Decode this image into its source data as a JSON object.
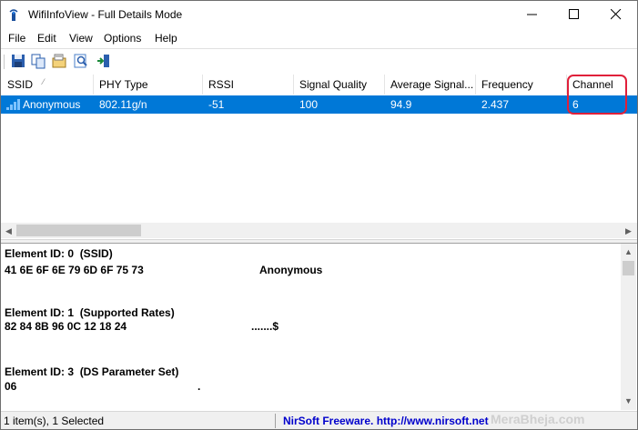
{
  "window": {
    "title": "WifiInfoView  -  Full Details Mode"
  },
  "menu": [
    "File",
    "Edit",
    "View",
    "Options",
    "Help"
  ],
  "toolbar": {
    "icons": [
      "save-icon",
      "copy-icon",
      "properties-icon",
      "find-icon",
      "exit-icon"
    ]
  },
  "list": {
    "columns": [
      "SSID",
      "PHY Type",
      "RSSI",
      "Signal Quality",
      "Average Signal...",
      "Frequency",
      "Channel"
    ],
    "rows": [
      {
        "ssid": "Anonymous",
        "phy": "802.11g/n",
        "rssi": "-51",
        "quality": "100",
        "avg": "94.9",
        "freq": "2.437",
        "channel": "6"
      }
    ]
  },
  "details": {
    "lines": [
      "Element ID: 0  (SSID)",
      "41 6E 6F 6E 79 6D 6F 75 73",
      "Anonymous",
      "Element ID: 1  (Supported Rates)",
      "82 84 8B 96 0C 12 18 24",
      ".......$",
      "Element ID: 3  (DS Parameter Set)",
      "06",
      "."
    ]
  },
  "status": {
    "count": "1 item(s), 1 Selected",
    "credit": "NirSoft Freeware.  http://www.nirsoft.net"
  },
  "watermark": "MeraBheja.com",
  "colors": {
    "selection": "#0078d7",
    "highlight_border": "#e0203a",
    "link": "#0000cc"
  }
}
